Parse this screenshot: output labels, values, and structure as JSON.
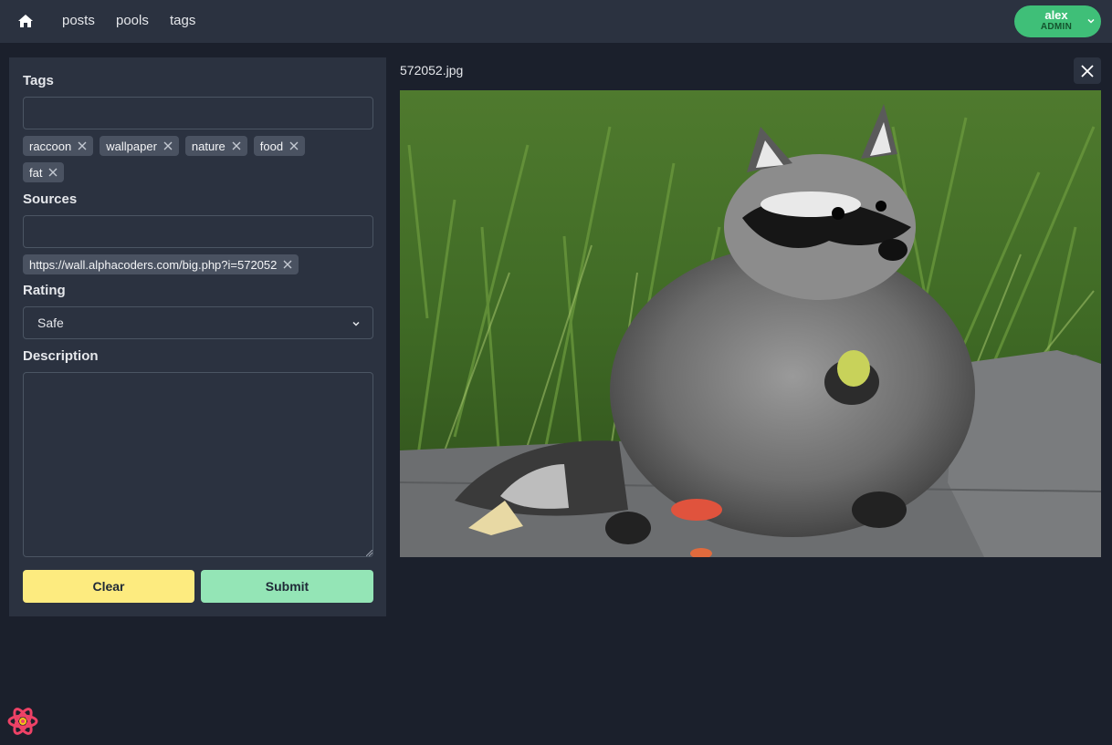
{
  "nav": {
    "home_icon": "home-icon",
    "links": [
      "posts",
      "pools",
      "tags"
    ]
  },
  "user": {
    "name": "alex",
    "role": "ADMIN",
    "accent": "#3fbf78"
  },
  "form": {
    "tags_label": "Tags",
    "tags_input_value": "",
    "tags": [
      "raccoon",
      "wallpaper",
      "nature",
      "food",
      "fat"
    ],
    "sources_label": "Sources",
    "sources_input_value": "",
    "sources": [
      "https://wall.alphacoders.com/big.php?i=572052"
    ],
    "rating_label": "Rating",
    "rating_value": "Safe",
    "description_label": "Description",
    "description_value": "",
    "clear_label": "Clear",
    "submit_label": "Submit",
    "clear_color": "#fdeb7f",
    "submit_color": "#94e5b6"
  },
  "preview": {
    "filename": "572052.jpg",
    "close_icon": "close-icon"
  }
}
